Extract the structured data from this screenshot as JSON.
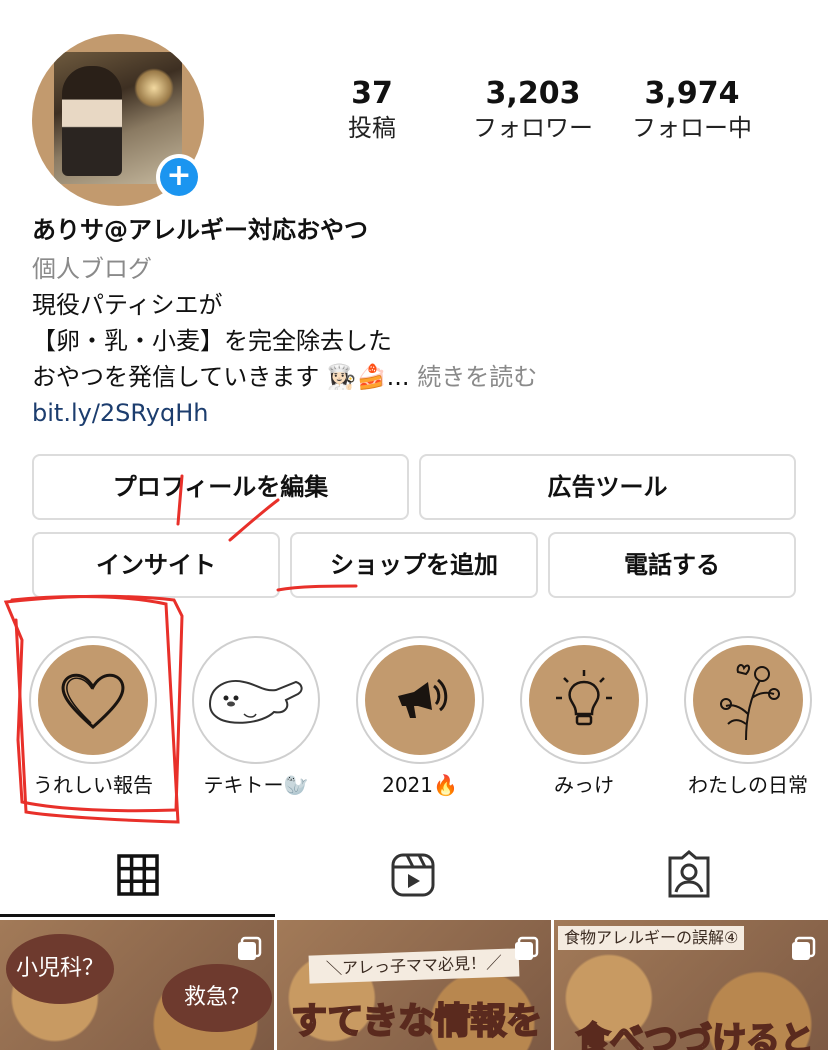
{
  "profile": {
    "stats": [
      {
        "count": "37",
        "label": "投稿"
      },
      {
        "count": "3,203",
        "label": "フォロワー"
      },
      {
        "count": "3,974",
        "label": "フォロー中"
      }
    ],
    "display_name": "ありサ@アレルギー対応おやつ",
    "category": "個人ブログ",
    "bio_lines": [
      "現役パティシエが",
      "【卵・乳・小麦】を完全除去した",
      "おやつを発信していきます 👩🏻‍🍳🍰..."
    ],
    "bio_more": "続きを読む",
    "link": "bit.ly/2SRyqHh"
  },
  "actions": {
    "edit_profile": "プロフィールを編集",
    "ad_tools": "広告ツール",
    "insights": "インサイト",
    "add_shop": "ショップを追加",
    "call": "電話する"
  },
  "highlights": [
    {
      "title": "うれしい報告",
      "icon": "heart-icon"
    },
    {
      "title": "テキトー🦭",
      "icon": "seal-icon"
    },
    {
      "title": "2021🔥",
      "icon": "megaphone-icon"
    },
    {
      "title": "みっけ",
      "icon": "lightbulb-icon"
    },
    {
      "title": "わたしの日常",
      "icon": "flower-icon"
    }
  ],
  "tabs": [
    {
      "name": "grid",
      "icon": "grid-icon",
      "active": true
    },
    {
      "name": "reels",
      "icon": "reels-icon",
      "active": false
    },
    {
      "name": "tagged",
      "icon": "tagged-icon",
      "active": false
    }
  ],
  "posts": [
    {
      "bubble1": "小児科？",
      "bubble2": "救急？"
    },
    {
      "banner": "＼アレっ子ママ必見！／",
      "headline": "すてきな情報を"
    },
    {
      "caption": "食物アレルギーの誤解④",
      "headline": "食べつづけると"
    }
  ],
  "colors": {
    "accent": "#1b95f0",
    "highlight_fill": "#c29a6e",
    "annotation": "#e8302a",
    "link": "#1c3d6e"
  }
}
